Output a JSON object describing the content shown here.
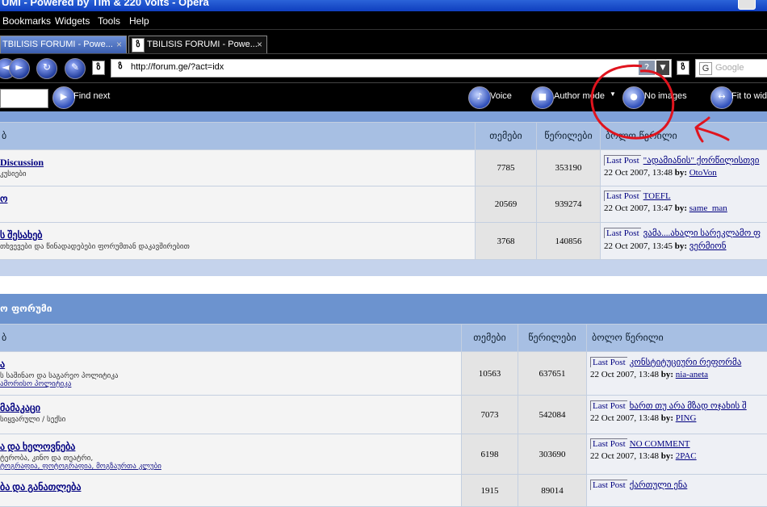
{
  "window": {
    "title": "UMI - Powered by Tim & 220 Volts - Opera"
  },
  "menu": {
    "items": [
      "Bookmarks",
      "Widgets",
      "Tools",
      "Help"
    ]
  },
  "tabs": [
    {
      "label": "TBILISIS FORUMI - Powe...",
      "active": false
    },
    {
      "label": "TBILISIS FORUMI - Powe...",
      "active": true
    }
  ],
  "address": {
    "url": "http://forum.ge/?act=idx",
    "search_placeholder": "Google"
  },
  "toolbar": {
    "find_next": "Find next",
    "voice": "Voice",
    "author_mode": "Author mode",
    "no_images": "No images",
    "fit_to_width": "Fit to wid"
  },
  "section1": {
    "headers": {
      "topics": "თემები",
      "posts": "წერილები",
      "last_post": "ბოლო წერილი"
    },
    "rows": [
      {
        "name": "Discussion",
        "desc": "კუსიები",
        "sub": "",
        "topics": "7785",
        "posts": "353190",
        "last_tag": "Last Post",
        "last_title": "\"ადამიანის\" ქორწილისთვი",
        "date": "22 Oct 2007, 13:48",
        "by": "by:",
        "user": "OtoVon"
      },
      {
        "name": "ო",
        "desc": "",
        "sub": "",
        "topics": "20569",
        "posts": "939274",
        "last_tag": "Last Post",
        "last_title": "TOEFL",
        "date": "22 Oct 2007, 13:47",
        "by": "by:",
        "user": "same_man"
      },
      {
        "name": "ს შესახებ",
        "desc": "თხვევები და წინადადებები ფორუმთან დაკავშირებით",
        "sub": "",
        "topics": "3768",
        "posts": "140856",
        "last_tag": "Last Post",
        "last_title": "ვამა....ახალი სარეკლამო ფ",
        "date": "22 Oct 2007, 13:45",
        "by": "by:",
        "user": "ვერმიონ"
      }
    ]
  },
  "category2": {
    "title": "ო ფორუმი"
  },
  "section2": {
    "headers": {
      "topics": "თემები",
      "posts": "წერილები",
      "last_post": "ბოლო წერილი"
    },
    "rows": [
      {
        "name": "ა",
        "desc": "ს საშინაო და საგარეო პოლიტიკა",
        "sub": "ამორისო პოლიტიკა",
        "topics": "10563",
        "posts": "637651",
        "last_tag": "Last Post",
        "last_title": "კონსტიტუციური რეფორმა",
        "date": "22 Oct 2007, 13:48",
        "by": "by:",
        "user": "nia-aneta"
      },
      {
        "name": "მამაკაცი",
        "desc": "სიყვარული / სექსი",
        "sub": "",
        "topics": "7073",
        "posts": "542084",
        "last_tag": "Last Post",
        "last_title": "ხართ თუ არა მზად ოჯახის შ",
        "date": "22 Oct 2007, 13:48",
        "by": "by:",
        "user": "PING"
      },
      {
        "name": "ა და ხელოვნება",
        "desc": "ტერობა, კინო და თეატრი,",
        "sub": "ტოგრაფია, ფოტოგრაფია, მოგზაურთა კლუბი",
        "topics": "6198",
        "posts": "303690",
        "last_tag": "Last Post",
        "last_title": "NO COMMENT",
        "date": "22 Oct 2007, 13:48",
        "by": "by:",
        "user": "2PAC"
      },
      {
        "name": "ბა და განათლება",
        "desc": "",
        "sub": "",
        "topics": "1915",
        "posts": "89014",
        "last_tag": "Last Post",
        "last_title": "ქართული ენა",
        "date": "",
        "by": "",
        "user": ""
      }
    ]
  },
  "colors": {
    "annotation": "#e0141e",
    "header_band": "#a7bfe3",
    "category": "#6c93cf"
  }
}
